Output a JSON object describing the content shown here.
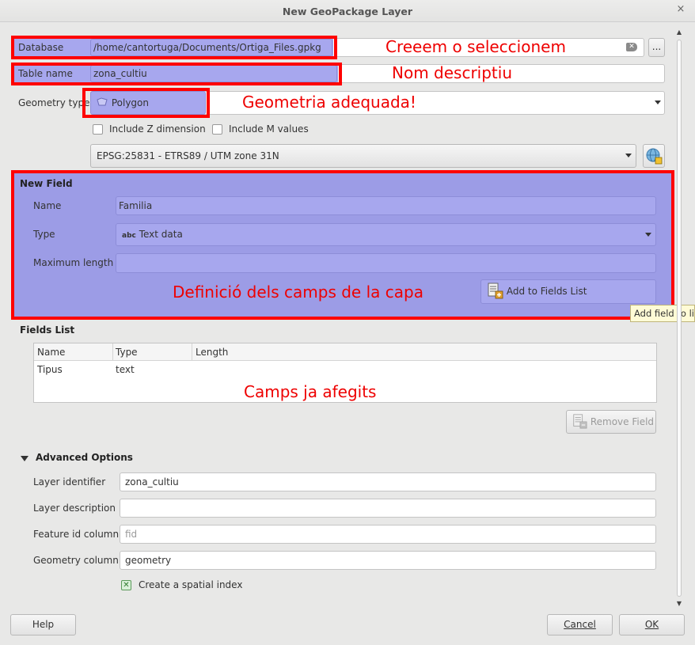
{
  "window": {
    "title": "New GeoPackage Layer",
    "close_glyph": "×"
  },
  "database": {
    "label": "Database",
    "value": "/home/cantortuga/Documents/Ortiga_Files.gpkg",
    "browse_label": "..."
  },
  "table_name": {
    "label": "Table name",
    "value": "zona_cultiu"
  },
  "geometry": {
    "label": "Geometry type",
    "value": "Polygon",
    "include_z_label": "Include Z dimension",
    "include_m_label": "Include M values",
    "crs_value": "EPSG:25831 - ETRS89 / UTM zone 31N"
  },
  "new_field": {
    "heading": "New Field",
    "name_label": "Name",
    "name_value": "Familia",
    "type_label": "Type",
    "type_prefix": "abc",
    "type_value": "Text data",
    "maxlen_label": "Maximum length",
    "maxlen_value": "",
    "add_button_label": "Add to Fields List",
    "tooltip": "Add field to list"
  },
  "fields_list": {
    "heading": "Fields List",
    "columns": [
      "Name",
      "Type",
      "Length"
    ],
    "rows": [
      {
        "name": "Tipus",
        "type": "text",
        "length": ""
      }
    ],
    "remove_button_label": "Remove Field"
  },
  "advanced": {
    "heading": "Advanced Options",
    "layer_identifier_label": "Layer identifier",
    "layer_identifier_value": "zona_cultiu",
    "layer_description_label": "Layer description",
    "layer_description_value": "",
    "feature_id_label": "Feature id column",
    "feature_id_placeholder": "fid",
    "geometry_column_label": "Geometry column",
    "geometry_column_value": "geometry",
    "spatial_index_label": "Create a spatial index",
    "spatial_index_checked": true
  },
  "buttons": {
    "help": "Help",
    "cancel": "Cancel",
    "ok": "OK"
  },
  "annotations": {
    "database": "Creeem o seleccionem",
    "table_name": "Nom descriptiu",
    "geometry": "Geometria adequada!",
    "new_field": "Definició dels camps de la capa",
    "fields_list": "Camps ja afegits"
  },
  "colors": {
    "highlight": "#a7a7ee",
    "annotation": "#ee0000",
    "annotation_box": "#ff0000"
  }
}
